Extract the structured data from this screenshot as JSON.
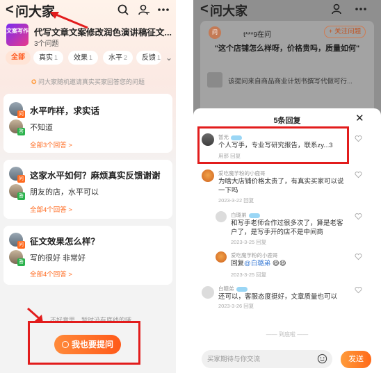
{
  "left": {
    "header": {
      "back": "<",
      "title": "问大家"
    },
    "store": {
      "logo_text": "文案写作",
      "name": "代写文章文案修改润色演讲稿征文...",
      "question_count": "3个问题"
    },
    "tabs": [
      {
        "label": "全部",
        "count": ""
      },
      {
        "label": "真实",
        "count": "1"
      },
      {
        "label": "效果",
        "count": "1"
      },
      {
        "label": "水平",
        "count": "2"
      },
      {
        "label": "反馈",
        "count": "1"
      }
    ],
    "notice": "问大家随机邀请真实买家回答您的问题",
    "questions": [
      {
        "question": "水平咋样，求实话",
        "answer": "不知道",
        "link": "全部3个回答 >"
      },
      {
        "question": "这家水平如何？麻烦真实反馈谢谢",
        "answer": "朋友的店，水平可以",
        "link": "全部4个回答 >"
      },
      {
        "question": "征文效果怎么样？",
        "answer": "写的很好 非常好",
        "link": "全部4个回答 >"
      }
    ],
    "hint": "不好意思，暂时没有底线的哦",
    "ask_button": "我也要提问"
  },
  "right": {
    "header": {
      "back": "<",
      "title": "问大家"
    },
    "background": {
      "badge": "问",
      "user": "t***9在问",
      "follow": "+ 关注问题",
      "question": "\"这个店铺怎么样呀，价格贵吗，质量如何\"",
      "ad": "该提问来自商品商业计划书撰写代做可行..."
    },
    "sheet_title": "5条回复",
    "replies": [
      {
        "name": "暂无",
        "text": "个人写手，专业写研究报告，联系zy...3",
        "meta": "用那   回复"
      },
      {
        "name": "爱吃魔芋粉的小鹿哥",
        "text": "为啥大店铺价格太贵了，有真实买家可以说一下吗",
        "meta": "2023-3-22      回复"
      },
      {
        "name": "白璐弟",
        "text": "和写手老师合作过很多次了，算是老客户了，是写手开的店不是中间商",
        "meta": "2023-3-25      回复"
      },
      {
        "name": "爱吃魔芋粉的小鹿哥",
        "text_prefix": "回复",
        "mention": "@白璐弟",
        "meta": "2023-3-25      回复"
      },
      {
        "name": "白糖弟",
        "text": "还可以，客服态度挺好，文章质量也可以",
        "meta": "2023-3-26      回复"
      }
    ],
    "end_text": "—— 到底啦 ——",
    "input": {
      "placeholder": "买家期待与你交流",
      "value": ""
    },
    "send": "发送"
  },
  "colors": {
    "accent": "#ff5a1f",
    "highlight": "#e21c1c",
    "mention": "#3a7bd5"
  }
}
